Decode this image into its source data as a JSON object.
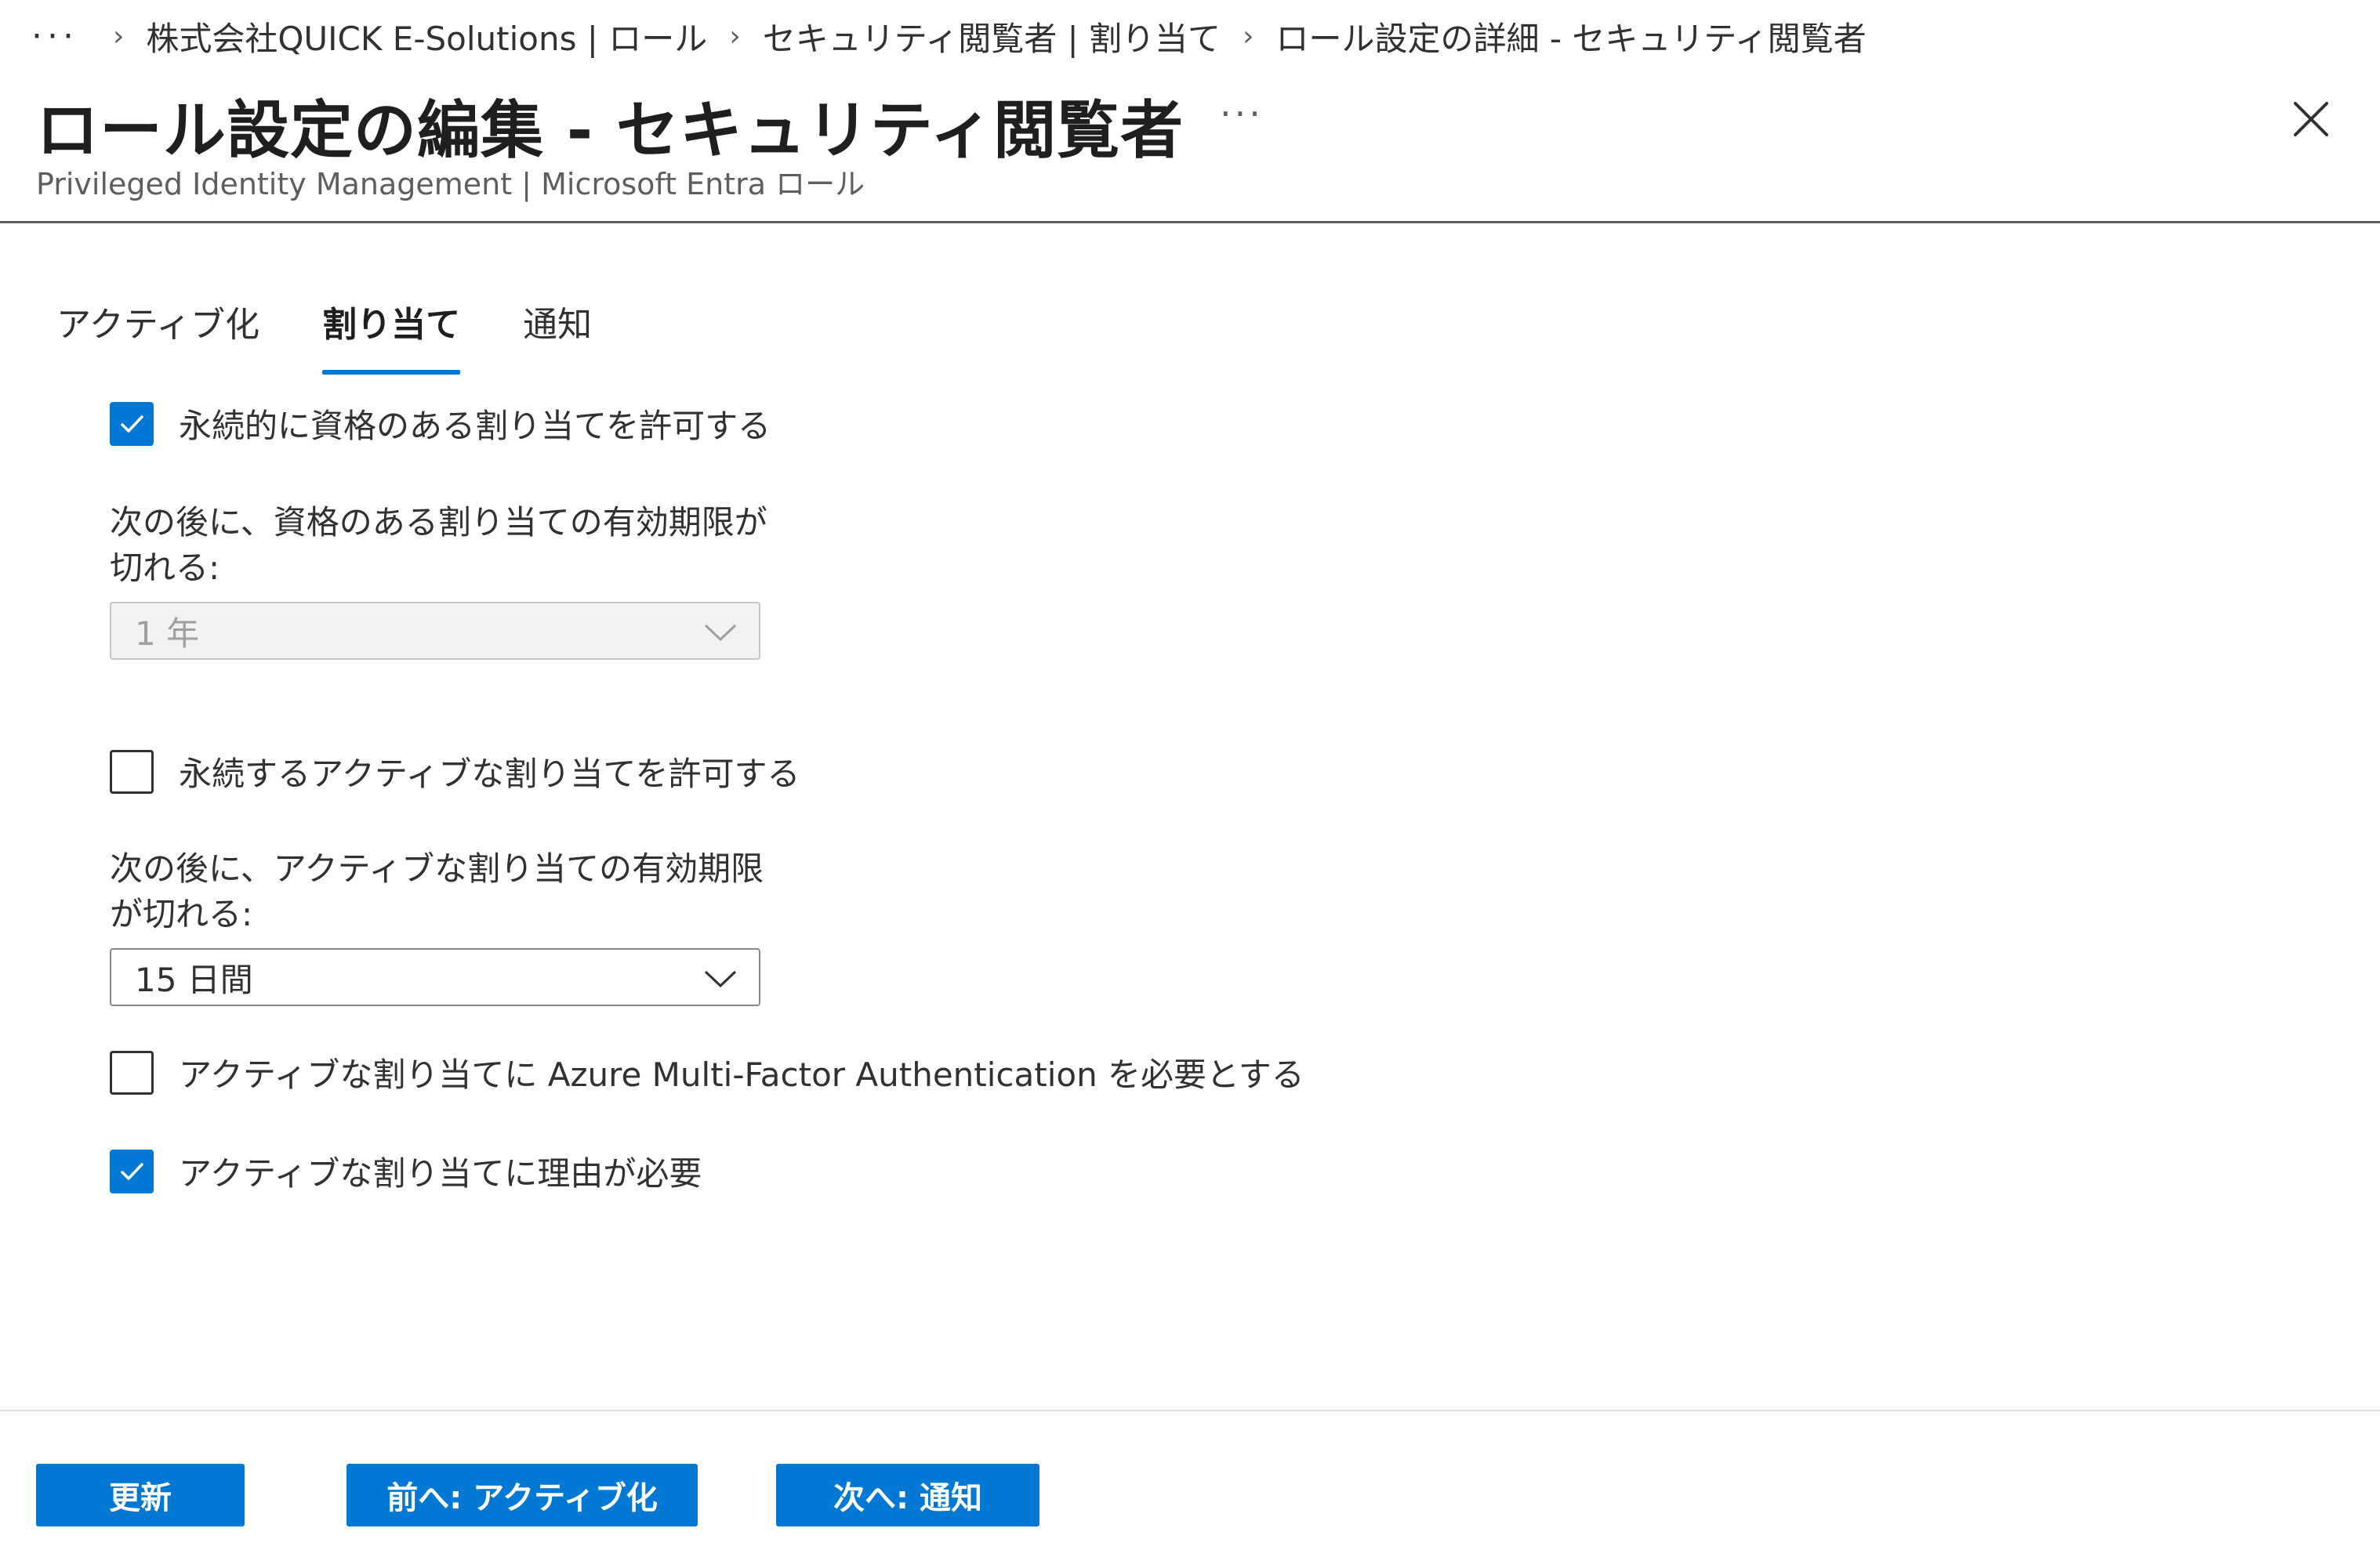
{
  "breadcrumb": {
    "more": "···",
    "items": [
      "株式会社QUICK E-Solutions | ロール",
      "セキュリティ閲覧者 | 割り当て",
      "ロール設定の詳細 - セキュリティ閲覧者"
    ],
    "separator": "›"
  },
  "header": {
    "title": "ロール設定の編集 - セキュリティ閲覧者",
    "more": "···",
    "subtitle": "Privileged Identity Management | Microsoft Entra ロール"
  },
  "tabs": [
    {
      "label": "アクティブ化",
      "active": false
    },
    {
      "label": "割り当て",
      "active": true
    },
    {
      "label": "通知",
      "active": false
    }
  ],
  "settings": {
    "permanent_eligible": {
      "label": "永続的に資格のある割り当てを許可する",
      "checked": true
    },
    "eligible_expire_label": "次の後に、資格のある割り当ての有効期限が切れる:",
    "eligible_expire_value": "1 年",
    "permanent_active": {
      "label": "永続するアクティブな割り当てを許可する",
      "checked": false
    },
    "active_expire_label": "次の後に、アクティブな割り当ての有効期限が切れる:",
    "active_expire_value": "15 日間",
    "require_mfa": {
      "label": "アクティブな割り当てに Azure Multi-Factor Authentication を必要とする",
      "checked": false
    },
    "require_justification": {
      "label": "アクティブな割り当てに理由が必要",
      "checked": true
    }
  },
  "footer": {
    "update": "更新",
    "previous": "前へ: アクティブ化",
    "next": "次へ: 通知"
  },
  "colors": {
    "accent": "#0078d4",
    "text": "#323130",
    "disabled_bg": "#f3f2f1"
  },
  "icons": {
    "close": "close-icon",
    "checkmark": "checkmark-icon",
    "chevron": "chevron-down-icon"
  }
}
